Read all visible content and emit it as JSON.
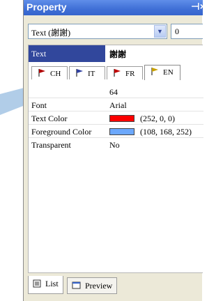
{
  "window": {
    "title": "Property",
    "pin_icon": "pin-icon"
  },
  "selector": {
    "value": "Text (謝謝)",
    "spinner_value": "0"
  },
  "text_property": {
    "label": "Text",
    "value": "謝謝"
  },
  "language_tabs": [
    {
      "label": "CH",
      "flag_color": "#b00000",
      "active": false
    },
    {
      "label": "IT",
      "flag_color": "#3040a0",
      "active": false
    },
    {
      "label": "FR",
      "flag_color": "#c00000",
      "active": false
    },
    {
      "label": "EN",
      "flag_color": "#c8a000",
      "active": true
    }
  ],
  "properties": [
    {
      "name": "",
      "value": "64"
    },
    {
      "name": "Font",
      "value": "Arial"
    },
    {
      "name": "Text Color",
      "value": "(252, 0, 0)",
      "color": "#fc0000"
    },
    {
      "name": "Foreground Color",
      "value": "(108, 168, 252)",
      "color": "#6ca8fc"
    },
    {
      "name": "Transparent",
      "value": "No"
    }
  ],
  "bottom_tabs": [
    {
      "label": "List",
      "icon": "list-icon",
      "active": true
    },
    {
      "label": "Preview",
      "icon": "preview-icon",
      "active": false
    }
  ]
}
